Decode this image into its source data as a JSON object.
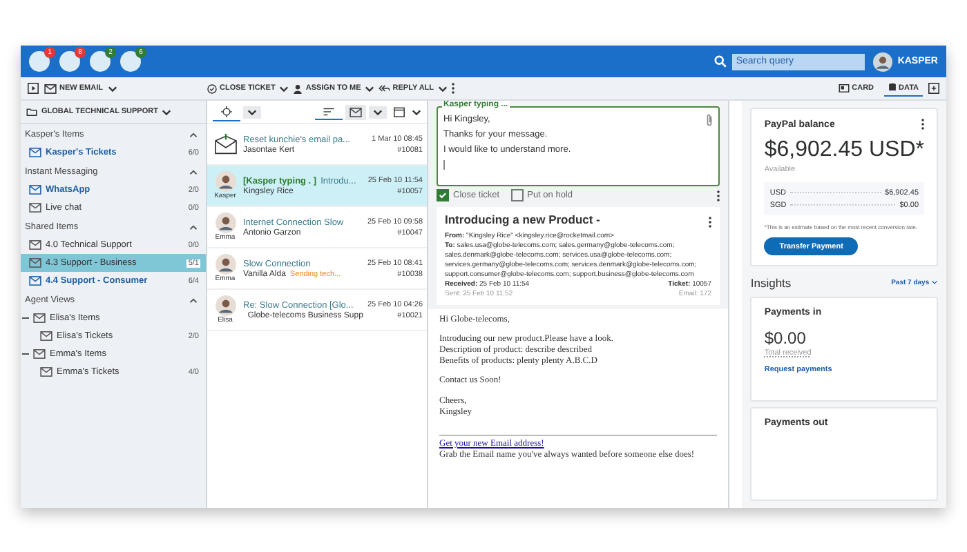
{
  "topbar": {
    "bubbles": [
      {
        "badge": "1",
        "color": "#e53935"
      },
      {
        "badge": "8",
        "color": "#e53935"
      },
      {
        "badge": "2",
        "color": "#2e7d32"
      },
      {
        "badge": "6",
        "color": "#2e7d32"
      }
    ],
    "search": {
      "placeholder": "Search query"
    },
    "user": "KASPER"
  },
  "toolbar": {
    "new_email": "NEW EMAIL",
    "actions": [
      "CLOSE TICKET",
      "ASSIGN TO ME",
      "REPLY ALL"
    ],
    "view_tabs": [
      {
        "label": "CARD",
        "selected": false
      },
      {
        "label": "DATA",
        "selected": true
      }
    ]
  },
  "sidebar": {
    "folder": "GLOBAL TECHNICAL SUPPORT",
    "sections": [
      {
        "title": "Kasper's Items",
        "expanded": true,
        "items": [
          {
            "label": "Kasper's Tickets",
            "count": "6/0",
            "unread": true,
            "selected": false
          }
        ]
      },
      {
        "title": "Instant Messaging",
        "expanded": true,
        "items": [
          {
            "label": "WhatsApp",
            "count": "2/0",
            "unread": true,
            "selected": false
          },
          {
            "label": "Live chat",
            "count": "0/0",
            "unread": false,
            "selected": false
          }
        ]
      },
      {
        "title": "Shared Items",
        "expanded": true,
        "items": [
          {
            "label": "4.0 Technical Support",
            "count": "0/0",
            "unread": false,
            "selected": false
          },
          {
            "label": "4.3 Support - Business",
            "count": "5/1",
            "unread": false,
            "selected": true
          },
          {
            "label": "4.4 Support - Consumer",
            "count": "6/4",
            "unread": true,
            "selected": false
          }
        ]
      },
      {
        "title": "Agent Views",
        "expanded": true,
        "items": [
          {
            "label": "Elisa's Items",
            "unread": false,
            "selected": false,
            "children": [
              {
                "label": "Elisa's Tickets",
                "count": "2/0",
                "unread": false,
                "selected": false
              }
            ]
          },
          {
            "label": "Emma's Items",
            "unread": false,
            "selected": false,
            "children": [
              {
                "label": "Emma's Tickets",
                "count": "4/0",
                "unread": false,
                "selected": false
              }
            ]
          }
        ]
      }
    ]
  },
  "tickets": [
    {
      "kind": "email",
      "subject": "Reset kunchie's email pa...",
      "from": "Jasontae Kert",
      "date": "1 Mar 10 08:45",
      "number": "#10081",
      "selected": false
    },
    {
      "kind": "avatar",
      "agent": "Kasper",
      "typing": "[Kasper typing . ]",
      "subject": "Introdu...",
      "from": "Kingsley Rice",
      "date": "25 Feb 10 11:54",
      "number": "#10057",
      "selected": true
    },
    {
      "kind": "avatar",
      "agent": "Emma",
      "subject": "Internet Connection Slow",
      "from": "Antonio Garzon",
      "date": "25 Feb 10 09:58",
      "number": "#10047",
      "selected": false
    },
    {
      "kind": "avatar",
      "agent": "Emma",
      "subject": "Slow Connection",
      "from": "Vanilla Alda",
      "tag": "Sending tech...",
      "date": "25 Feb 10 08:41",
      "number": "#10038",
      "selected": false
    },
    {
      "kind": "avatar",
      "agent": "Elisa",
      "subject": "Re: Slow Connection [Glo...",
      "from": "Globe-telecoms Business Supp",
      "thread": true,
      "date": "25 Feb 10 04:26",
      "number": "#10021",
      "selected": false
    }
  ],
  "compose": {
    "legend": "Kasper typing ...",
    "lines": [
      "Hi Kingsley,",
      "Thanks for your message.",
      "I would like to understand more."
    ],
    "options": [
      {
        "label": "Close ticket",
        "checked": true
      },
      {
        "label": "Put on hold",
        "checked": false
      }
    ]
  },
  "email": {
    "subject": "Introducing a new Product -",
    "from_label": "From:",
    "from": "\"Kingsley Rice\" <kingsley.rice@rocketmail.com>",
    "to_label": "To:",
    "to": "sales.usa@globe-telecoms.com; sales.germany@globe-telecoms.com; sales.denmark@globe-telecoms.com; services.usa@globe-telecoms.com; services.germany@globe-telecoms.com; services.denmark@globe-telecoms.com; support.consumer@globe-telecoms.com; support.business@globe-telecoms.com",
    "received_label": "Received:",
    "received": "25 Feb 10 11:54",
    "ticket_label": "Ticket:",
    "ticket": "10057",
    "sent": "Sent: 25 Feb 10 11:52",
    "email_no": "Email: 172",
    "body": [
      [
        "Hi Globe-telecoms,"
      ],
      [
        "Introducing our new product.Please have a look.",
        "Description of product: describe described",
        "Benefits of products: plenty plenty A.B.C.D"
      ],
      [
        "Contact us Soon!"
      ],
      [
        "Cheers,",
        "Kingsley"
      ]
    ],
    "link": "Get your new Email address!",
    "footer": "Grab the Email name you've always wanted before someone else does!"
  },
  "paypal": {
    "title": "PayPal balance",
    "amount": "$6,902.45 USD*",
    "available": "Available",
    "rows": [
      {
        "currency": "USD",
        "value": "$6,902.45"
      },
      {
        "currency": "SGD",
        "value": "$0.00"
      }
    ],
    "note": "*This is an estimate based on the most recent conversion rate.",
    "button": "Transfer Payment",
    "insights": "Insights",
    "period": "Past 7 days",
    "payments_in": {
      "title": "Payments in",
      "amount": "$0.00",
      "caption": "Total received",
      "link": "Request payments"
    },
    "payments_out": "Payments out"
  }
}
